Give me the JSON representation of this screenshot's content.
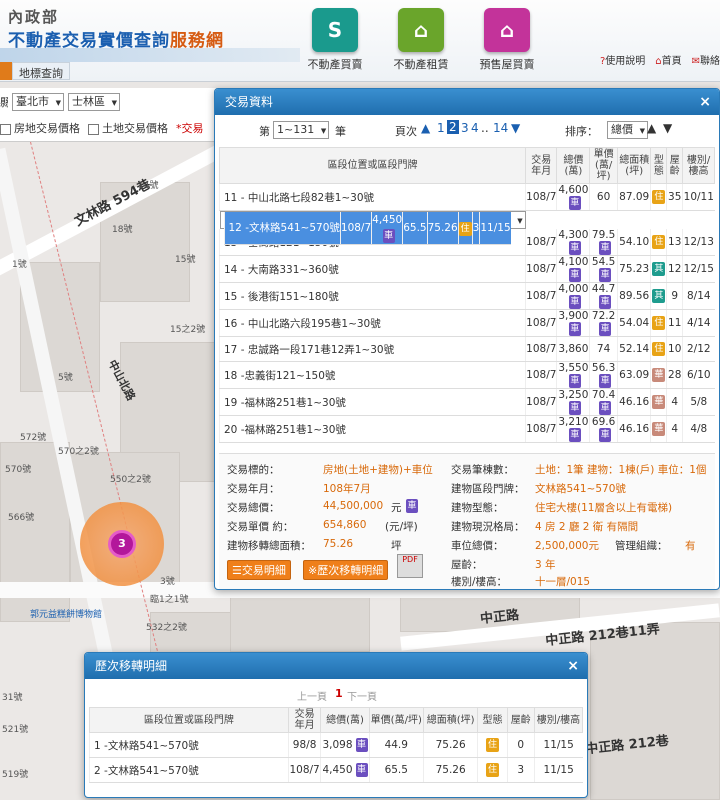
{
  "header": {
    "agency": "內政部",
    "site_title_main": "不動產交易實價查詢",
    "site_title_service": "服務網",
    "nav": [
      {
        "label": "不動產買賣",
        "icon": "S",
        "color": "#1a9a8d"
      },
      {
        "label": "不動產租賃",
        "icon": "⌂",
        "color": "#6aa52b"
      },
      {
        "label": "預售屋買賣",
        "icon": "⌂",
        "color": "#c3339a"
      }
    ],
    "links": [
      "使用說明",
      "首頁",
      "聯絡"
    ],
    "tab": "地標查詢"
  },
  "filters": {
    "city": "臺北市",
    "district": "士林區",
    "opt_house": "房地交易價格",
    "opt_land": "土地交易價格",
    "opt_trade": "*交易"
  },
  "map": {
    "roads": [
      "文林路 594巷",
      "中正路 212巷11弄",
      "中正路",
      "中山北路",
      "中正路 212巷"
    ],
    "cluster_count": "3",
    "poi": "郭元益糕餅博物館"
  },
  "trade_panel": {
    "title": "交易資料",
    "close": "×",
    "page_prefix": "第",
    "page_select": "1~131",
    "page_suffix": "筆",
    "pages_label": "頁次",
    "pages": [
      "1",
      "2",
      "3",
      "4",
      "..",
      "14"
    ],
    "current_page": "2",
    "sort_label": "排序：",
    "sort_value": "總價",
    "columns": [
      "區段位置或區段門牌",
      "交易年月",
      "總價(萬)",
      "單價(萬/坪)",
      "總面積(坪)",
      "型態",
      "屋齡",
      "樓別/樓高"
    ],
    "rows": [
      {
        "no": "11",
        "addr": "- 中山北路七段82巷1~30號",
        "ym": "108/7",
        "total": "4,600",
        "car": true,
        "unit": "60",
        "ucar": false,
        "area": "87.09",
        "type": "住",
        "tcolor": "zhu",
        "age": "35",
        "floor": "10/11"
      },
      {
        "no": "12",
        "addr": "-文林路541~570號",
        "ym": "108/7",
        "total": "4,450",
        "car": true,
        "unit": "65.5",
        "ucar": false,
        "area": "75.26",
        "type": "住",
        "tcolor": "zhu",
        "age": "3",
        "floor": "11/15",
        "selected": true
      },
      {
        "no": "13",
        "addr": "- 士商路121~150號",
        "ym": "108/7",
        "total": "4,300",
        "car": true,
        "unit": "79.5",
        "ucar": true,
        "area": "54.10",
        "type": "住",
        "tcolor": "zhu",
        "age": "13",
        "floor": "12/13"
      },
      {
        "no": "14",
        "addr": "- 大南路331~360號",
        "ym": "108/7",
        "total": "4,100",
        "car": true,
        "unit": "54.5",
        "ucar": true,
        "area": "75.23",
        "type": "其",
        "tcolor": "qi",
        "age": "12",
        "floor": "12/15"
      },
      {
        "no": "15",
        "addr": "- 後港街151~180號",
        "ym": "108/7",
        "total": "4,000",
        "car": true,
        "unit": "44.7",
        "ucar": true,
        "area": "89.56",
        "type": "其",
        "tcolor": "qi",
        "age": "9",
        "floor": "8/14"
      },
      {
        "no": "16",
        "addr": "- 中山北路六段195巷1~30號",
        "ym": "108/7",
        "total": "3,900",
        "car": true,
        "unit": "72.2",
        "ucar": true,
        "area": "54.04",
        "type": "住",
        "tcolor": "zhu",
        "age": "11",
        "floor": "4/14"
      },
      {
        "no": "17",
        "addr": "- 忠誠路一段171巷12弄1~30號",
        "ym": "108/7",
        "total": "3,860",
        "car": false,
        "unit": "74",
        "ucar": false,
        "area": "52.14",
        "type": "住",
        "tcolor": "zhu",
        "age": "10",
        "floor": "2/12"
      },
      {
        "no": "18",
        "addr": "-忠義街121~150號",
        "ym": "108/7",
        "total": "3,550",
        "car": true,
        "unit": "56.3",
        "ucar": true,
        "area": "63.09",
        "type": "華",
        "tcolor": "hua",
        "age": "28",
        "floor": "6/10"
      },
      {
        "no": "19",
        "addr": "-福林路251巷1~30號",
        "ym": "108/7",
        "total": "3,250",
        "car": true,
        "unit": "70.4",
        "ucar": true,
        "area": "46.16",
        "type": "華",
        "tcolor": "hua",
        "age": "4",
        "floor": "5/8"
      },
      {
        "no": "20",
        "addr": "-福林路251巷1~30號",
        "ym": "108/7",
        "total": "3,210",
        "car": true,
        "unit": "69.6",
        "ucar": true,
        "area": "46.16",
        "type": "華",
        "tcolor": "hua",
        "age": "4",
        "floor": "4/8"
      }
    ],
    "car_badge": "車",
    "detail": {
      "target_label": "交易標的：",
      "target_value": "房地(土地+建物)+車位",
      "ym_label": "交易年月：",
      "ym_value": "108年7月",
      "total_label": "交易總價：",
      "total_value": "44,500,000",
      "total_unit": "元",
      "unit_label": "交易單價 約：",
      "unit_value": "654,860",
      "unit_unit": "(元/坪)",
      "area_label": "建物移轉總面積：",
      "area_value": "75.26",
      "area_unit": "坪",
      "count_label": "交易筆棟數：",
      "count_value": "土地：1筆 建物：1棟(戶) 車位：1個",
      "door_label": "建物區段門牌：",
      "door_value": "文林路541~570號",
      "btype_label": "建物型態：",
      "btype_value": "住宅大樓(11層含以上有電梯)",
      "layout_label": "建物現況格局：",
      "layout_value": "4 房 2 廳 2 衛 有隔間",
      "park_label": "車位總價：",
      "park_value": "2,500,000元",
      "mgmt_label": "管理組織：",
      "mgmt_value": "有",
      "age_label": "屋齡：",
      "age_value": "3 年",
      "floor_label": "樓別/樓高：",
      "floor_value": "十一層/015",
      "btn_detail": "交易明細",
      "btn_history": "※歷次移轉明細",
      "pdf": "PDF"
    }
  },
  "history_panel": {
    "title": "歷次移轉明細",
    "close": "×",
    "prev": "上一頁",
    "page": "1",
    "next": "下一頁",
    "columns": [
      "區段位置或區段門牌",
      "交易年月",
      "總價(萬)",
      "單價(萬/坪)",
      "總面積(坪)",
      "型態",
      "屋齡",
      "樓別/樓高"
    ],
    "rows": [
      {
        "no": "1",
        "addr": "-文林路541~570號",
        "ym": "98/8",
        "total": "3,098",
        "unit": "44.9",
        "area": "75.26",
        "type": "住",
        "age": "0",
        "floor": "11/15"
      },
      {
        "no": "2",
        "addr": "-文林路541~570號",
        "ym": "108/7",
        "total": "4,450",
        "unit": "65.5",
        "area": "75.26",
        "type": "住",
        "age": "3",
        "floor": "11/15"
      }
    ]
  }
}
